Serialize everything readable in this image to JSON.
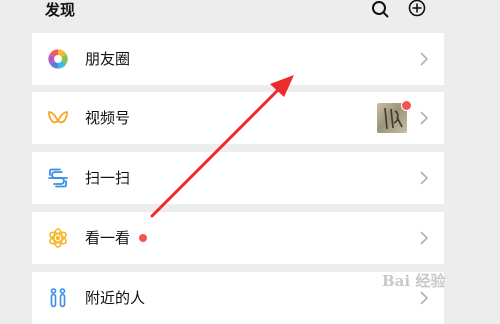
{
  "header": {
    "title": "发现"
  },
  "items": [
    {
      "label": "朋友圈"
    },
    {
      "label": "视频号"
    },
    {
      "label": "扫一扫"
    },
    {
      "label": "看一看"
    },
    {
      "label": "附近的人"
    }
  ],
  "watermark": "Bai 经验",
  "colors": {
    "background": "#ededed",
    "card": "#ffffff",
    "badge": "#f25454",
    "arrow": "#ee2b2b",
    "chevron": "#b2b2b2"
  },
  "icons": [
    "search-icon",
    "add-icon",
    "moments-icon",
    "channels-icon",
    "scan-icon",
    "top-stories-icon",
    "people-nearby-icon",
    "chevron-right-icon"
  ]
}
